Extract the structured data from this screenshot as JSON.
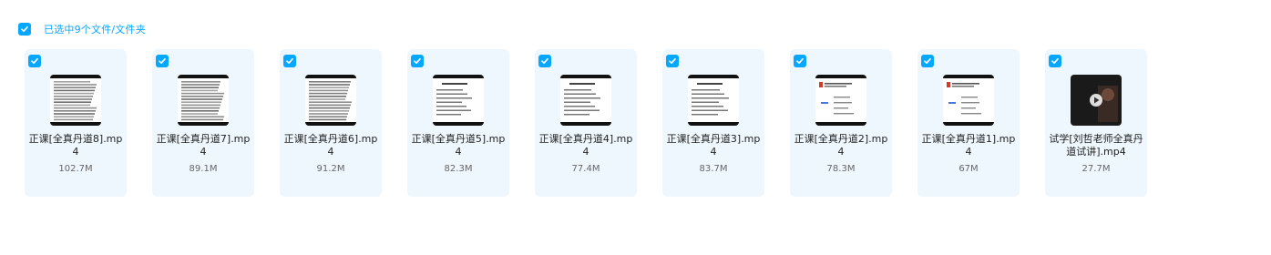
{
  "selection": {
    "label": "已选中9个文件/文件夹"
  },
  "accent_color": "#06a7ff",
  "files": [
    {
      "name": "正课[全真丹道8].mp4",
      "size": "102.7M",
      "thumb": "text-dense",
      "checked": true
    },
    {
      "name": "正课[全真丹道7].mp4",
      "size": "89.1M",
      "thumb": "text-dense",
      "checked": true
    },
    {
      "name": "正课[全真丹道6].mp4",
      "size": "91.2M",
      "thumb": "text-dense",
      "checked": true
    },
    {
      "name": "正课[全真丹道5].mp4",
      "size": "82.3M",
      "thumb": "slide-text",
      "checked": true
    },
    {
      "name": "正课[全真丹道4].mp4",
      "size": "77.4M",
      "thumb": "slide-text",
      "checked": true
    },
    {
      "name": "正课[全真丹道3].mp4",
      "size": "83.7M",
      "thumb": "slide-text",
      "checked": true
    },
    {
      "name": "正课[全真丹道2].mp4",
      "size": "78.3M",
      "thumb": "slide-diagram",
      "checked": true
    },
    {
      "name": "正课[全真丹道1].mp4",
      "size": "67M",
      "thumb": "slide-diagram",
      "checked": true
    },
    {
      "name": "试学[刘哲老师全真丹道试讲].mp4",
      "size": "27.7M",
      "thumb": "video-dark",
      "checked": true
    }
  ]
}
